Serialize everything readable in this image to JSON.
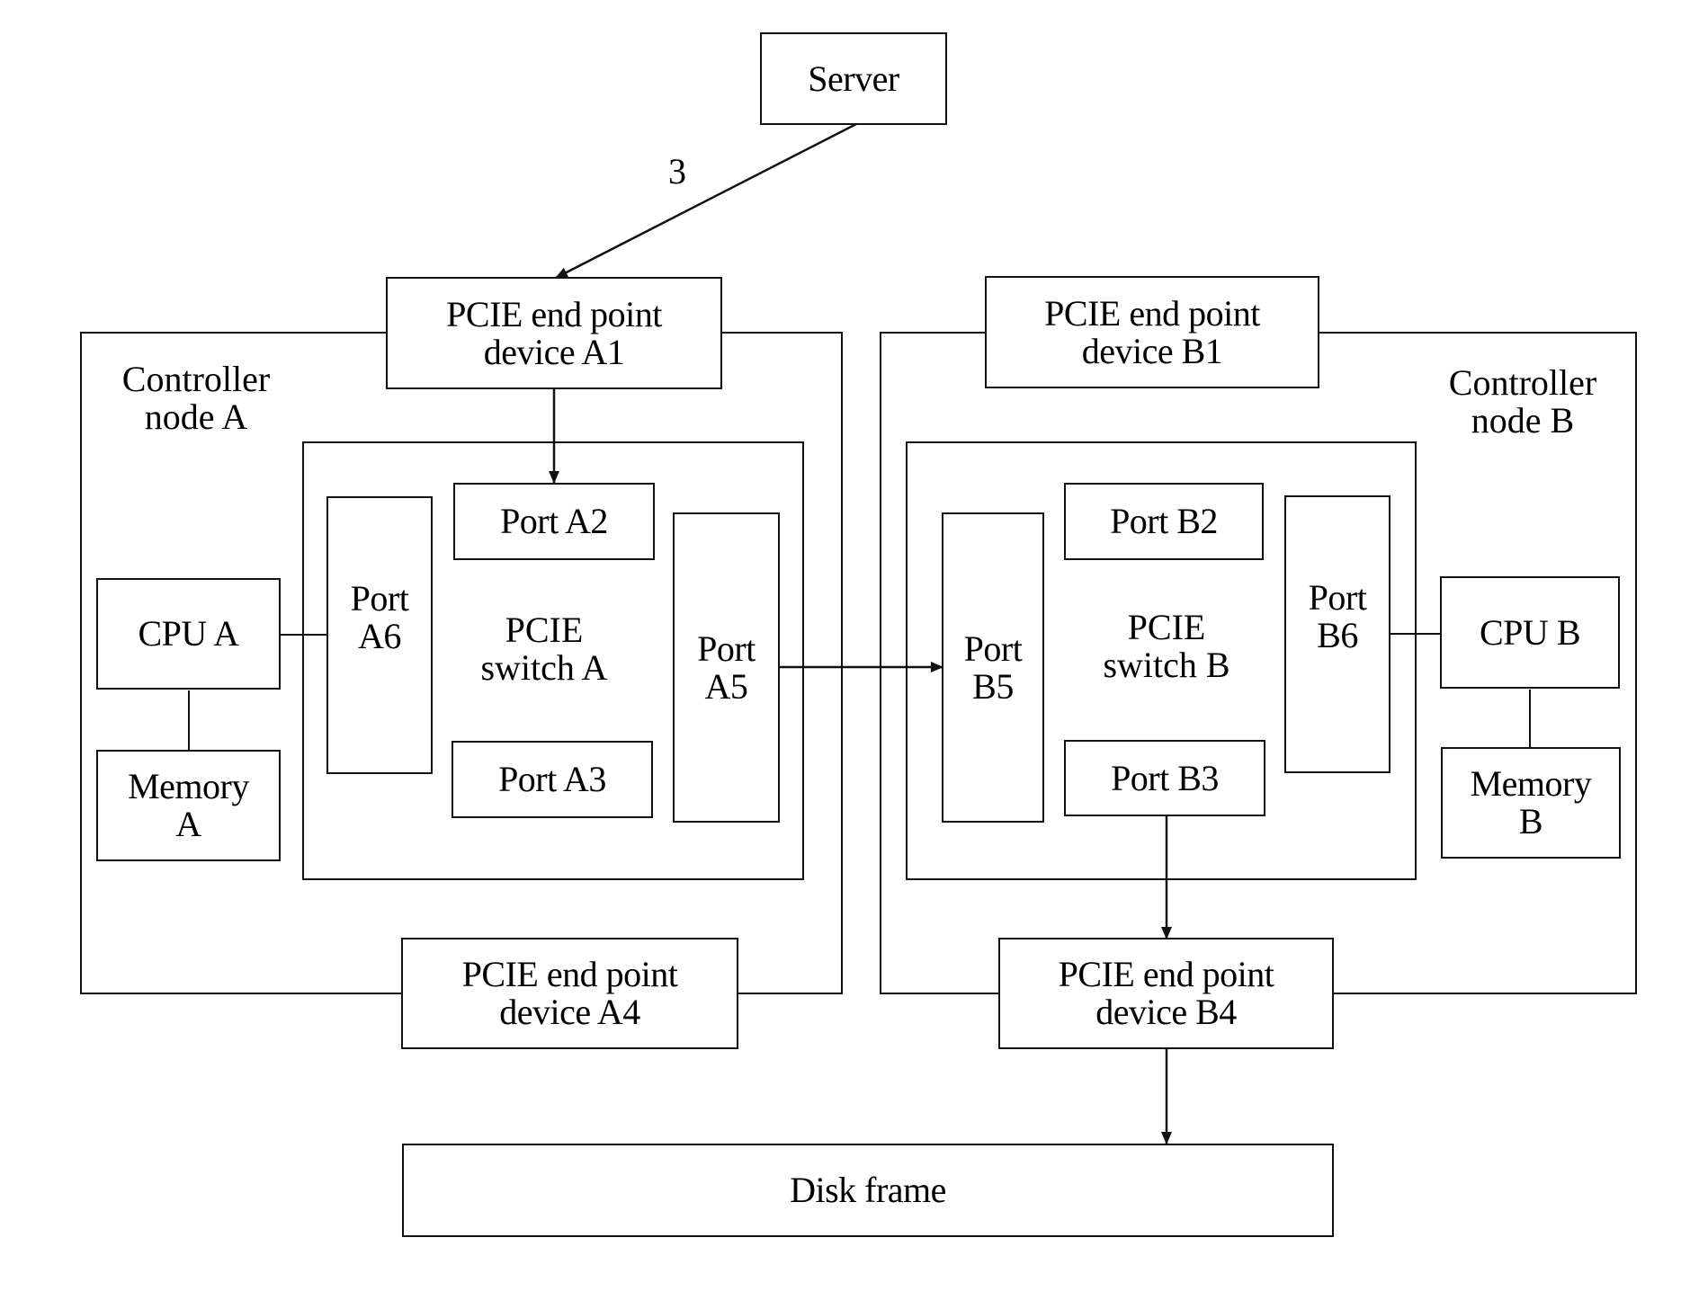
{
  "diagram": {
    "server": {
      "label": "Server"
    },
    "edge_label": "3",
    "controller_a": {
      "label": "Controller\nnode A",
      "endpoint_top": "PCIE end point\ndevice A1",
      "endpoint_bottom": "PCIE end point\ndevice A4",
      "cpu": "CPU A",
      "memory": "Memory\nA",
      "switch": {
        "label": "PCIE\nswitch A",
        "ports": {
          "top": "Port A2",
          "bottom": "Port A3",
          "right": "Port\nA5",
          "left": "Port\nA6"
        }
      }
    },
    "controller_b": {
      "label": "Controller\nnode B",
      "endpoint_top": "PCIE end point\ndevice B1",
      "endpoint_bottom": "PCIE end point\ndevice B4",
      "cpu": "CPU B",
      "memory": "Memory\nB",
      "switch": {
        "label": "PCIE\nswitch B",
        "ports": {
          "top": "Port B2",
          "bottom": "Port B3",
          "left": "Port\nB5",
          "right": "Port\nB6"
        }
      }
    },
    "disk_frame": {
      "label": "Disk frame"
    },
    "connections": [
      {
        "from": "Server",
        "to": "PCIE end point device A1",
        "label": "3",
        "arrow": true
      },
      {
        "from": "PCIE end point device A1",
        "to": "Port A2",
        "arrow": true
      },
      {
        "from": "CPU A",
        "to": "Port A6",
        "arrow": false
      },
      {
        "from": "CPU A",
        "to": "Memory A",
        "arrow": false
      },
      {
        "from": "Port A5",
        "to": "Port B5",
        "arrow": true
      },
      {
        "from": "Port B6",
        "to": "CPU B",
        "arrow": false
      },
      {
        "from": "CPU B",
        "to": "Memory B",
        "arrow": false
      },
      {
        "from": "Port B3",
        "to": "PCIE end point device B4",
        "arrow": true
      },
      {
        "from": "PCIE end point device B4",
        "to": "Disk frame",
        "arrow": true
      }
    ]
  }
}
